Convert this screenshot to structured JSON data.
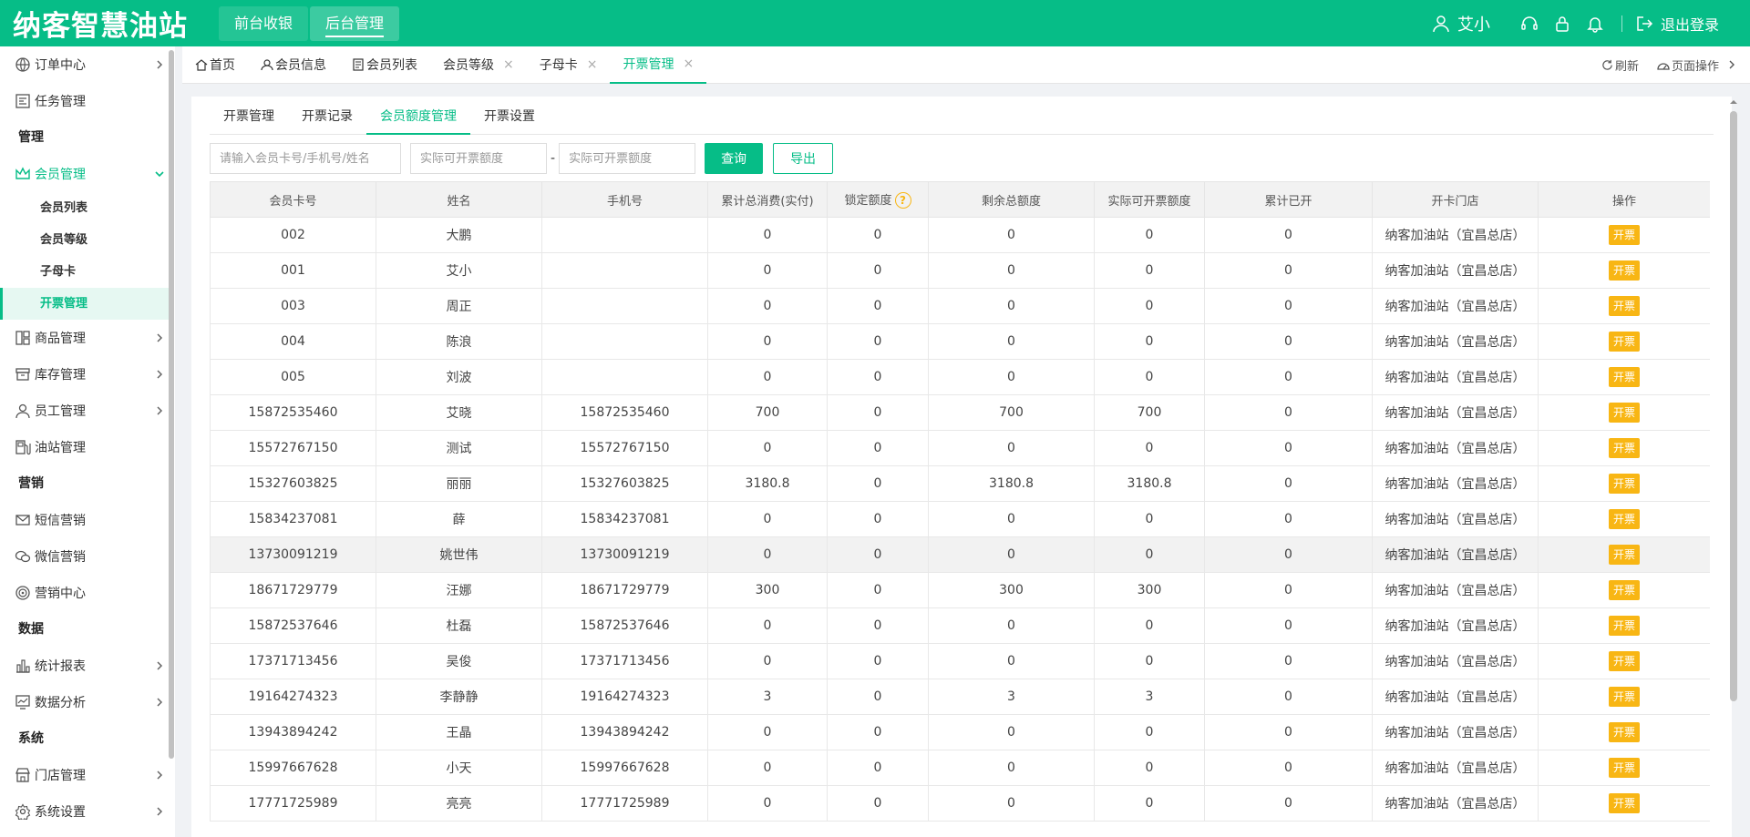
{
  "header": {
    "logo": "纳客智慧油站",
    "nav": [
      {
        "label": "前台收银",
        "active": false
      },
      {
        "label": "后台管理",
        "active": true
      }
    ],
    "user_name": "艾小",
    "logout_label": "退出登录"
  },
  "sidebar": {
    "items": [
      {
        "type": "item",
        "label": "订单中心",
        "icon": "globe-icon",
        "arrow": true
      },
      {
        "type": "item",
        "label": "任务管理",
        "icon": "task-icon",
        "arrow": false
      },
      {
        "type": "group",
        "label": "管理"
      },
      {
        "type": "item",
        "label": "会员管理",
        "icon": "crown-icon",
        "arrow": "down",
        "open": true
      },
      {
        "type": "sub",
        "label": "会员列表"
      },
      {
        "type": "sub",
        "label": "会员等级"
      },
      {
        "type": "sub",
        "label": "子母卡"
      },
      {
        "type": "sub",
        "label": "开票管理",
        "active": true
      },
      {
        "type": "item",
        "label": "商品管理",
        "icon": "goods-icon",
        "arrow": true
      },
      {
        "type": "item",
        "label": "库存管理",
        "icon": "inventory-icon",
        "arrow": true
      },
      {
        "type": "item",
        "label": "员工管理",
        "icon": "user-icon",
        "arrow": true
      },
      {
        "type": "item",
        "label": "油站管理",
        "icon": "fuel-icon",
        "arrow": false
      },
      {
        "type": "group",
        "label": "营销"
      },
      {
        "type": "item",
        "label": "短信营销",
        "icon": "mail-icon",
        "arrow": false
      },
      {
        "type": "item",
        "label": "微信营销",
        "icon": "wechat-icon",
        "arrow": false
      },
      {
        "type": "item",
        "label": "营销中心",
        "icon": "target-icon",
        "arrow": false
      },
      {
        "type": "group",
        "label": "数据"
      },
      {
        "type": "item",
        "label": "统计报表",
        "icon": "bar-chart-icon",
        "arrow": true
      },
      {
        "type": "item",
        "label": "数据分析",
        "icon": "analysis-icon",
        "arrow": true
      },
      {
        "type": "group",
        "label": "系统"
      },
      {
        "type": "item",
        "label": "门店管理",
        "icon": "store-icon",
        "arrow": true
      },
      {
        "type": "item",
        "label": "系统设置",
        "icon": "gear-icon",
        "arrow": true
      }
    ]
  },
  "tabs": {
    "items": [
      {
        "label": "首页",
        "icon": "home-icon",
        "closable": false,
        "active": false
      },
      {
        "label": "会员信息",
        "icon": "member-icon",
        "closable": false,
        "active": false
      },
      {
        "label": "会员列表",
        "icon": "list-icon",
        "closable": false,
        "active": false
      },
      {
        "label": "会员等级",
        "icon": "",
        "closable": true,
        "active": false
      },
      {
        "label": "子母卡",
        "icon": "",
        "closable": true,
        "active": false
      },
      {
        "label": "开票管理",
        "icon": "",
        "closable": true,
        "active": true
      }
    ],
    "refresh_label": "刷新",
    "page_ops_label": "页面操作"
  },
  "subtabs": [
    {
      "label": "开票管理",
      "active": false
    },
    {
      "label": "开票记录",
      "active": false
    },
    {
      "label": "会员额度管理",
      "active": true
    },
    {
      "label": "开票设置",
      "active": false
    }
  ],
  "filters": {
    "search_placeholder": "请输入会员卡号/手机号/姓名",
    "min_placeholder": "实际可开票额度",
    "max_placeholder": "实际可开票额度",
    "dash": "-",
    "query_label": "查询",
    "export_label": "导出"
  },
  "table": {
    "columns": [
      "会员卡号",
      "姓名",
      "手机号",
      "累计总消费(实付)",
      "锁定额度",
      "剩余总额度",
      "实际可开票额度",
      "累计已开",
      "开卡门店",
      "操作"
    ],
    "help_mark": "?",
    "action_label": "开票",
    "rows": [
      [
        "002",
        "大鹏",
        "",
        "0",
        "0",
        "0",
        "0",
        "0",
        "纳客加油站（宜昌总店）"
      ],
      [
        "001",
        "艾小",
        "",
        "0",
        "0",
        "0",
        "0",
        "0",
        "纳客加油站（宜昌总店）"
      ],
      [
        "003",
        "周正",
        "",
        "0",
        "0",
        "0",
        "0",
        "0",
        "纳客加油站（宜昌总店）"
      ],
      [
        "004",
        "陈浪",
        "",
        "0",
        "0",
        "0",
        "0",
        "0",
        "纳客加油站（宜昌总店）"
      ],
      [
        "005",
        "刘波",
        "",
        "0",
        "0",
        "0",
        "0",
        "0",
        "纳客加油站（宜昌总店）"
      ],
      [
        "15872535460",
        "艾晓",
        "15872535460",
        "700",
        "0",
        "700",
        "700",
        "0",
        "纳客加油站（宜昌总店）"
      ],
      [
        "15572767150",
        "测试",
        "15572767150",
        "0",
        "0",
        "0",
        "0",
        "0",
        "纳客加油站（宜昌总店）"
      ],
      [
        "15327603825",
        "丽丽",
        "15327603825",
        "3180.8",
        "0",
        "3180.8",
        "3180.8",
        "0",
        "纳客加油站（宜昌总店）"
      ],
      [
        "15834237081",
        "薛",
        "15834237081",
        "0",
        "0",
        "0",
        "0",
        "0",
        "纳客加油站（宜昌总店）"
      ],
      [
        "13730091219",
        "姚世伟",
        "13730091219",
        "0",
        "0",
        "0",
        "0",
        "0",
        "纳客加油站（宜昌总店）"
      ],
      [
        "18671729779",
        "汪娜",
        "18671729779",
        "300",
        "0",
        "300",
        "300",
        "0",
        "纳客加油站（宜昌总店）"
      ],
      [
        "15872537646",
        "杜磊",
        "15872537646",
        "0",
        "0",
        "0",
        "0",
        "0",
        "纳客加油站（宜昌总店）"
      ],
      [
        "17371713456",
        "吴俊",
        "17371713456",
        "0",
        "0",
        "0",
        "0",
        "0",
        "纳客加油站（宜昌总店）"
      ],
      [
        "19164274323",
        "李静静",
        "19164274323",
        "3",
        "0",
        "3",
        "3",
        "0",
        "纳客加油站（宜昌总店）"
      ],
      [
        "13943894242",
        "王晶",
        "13943894242",
        "0",
        "0",
        "0",
        "0",
        "0",
        "纳客加油站（宜昌总店）"
      ],
      [
        "15997667628",
        "小天",
        "15997667628",
        "0",
        "0",
        "0",
        "0",
        "0",
        "纳客加油站（宜昌总店）"
      ],
      [
        "17771725989",
        "亮亮",
        "17771725989",
        "0",
        "0",
        "0",
        "0",
        "0",
        "纳客加油站（宜昌总店）"
      ]
    ],
    "highlight_row": 9
  },
  "colors": {
    "brand": "#06bd87",
    "action": "#f8b614"
  }
}
